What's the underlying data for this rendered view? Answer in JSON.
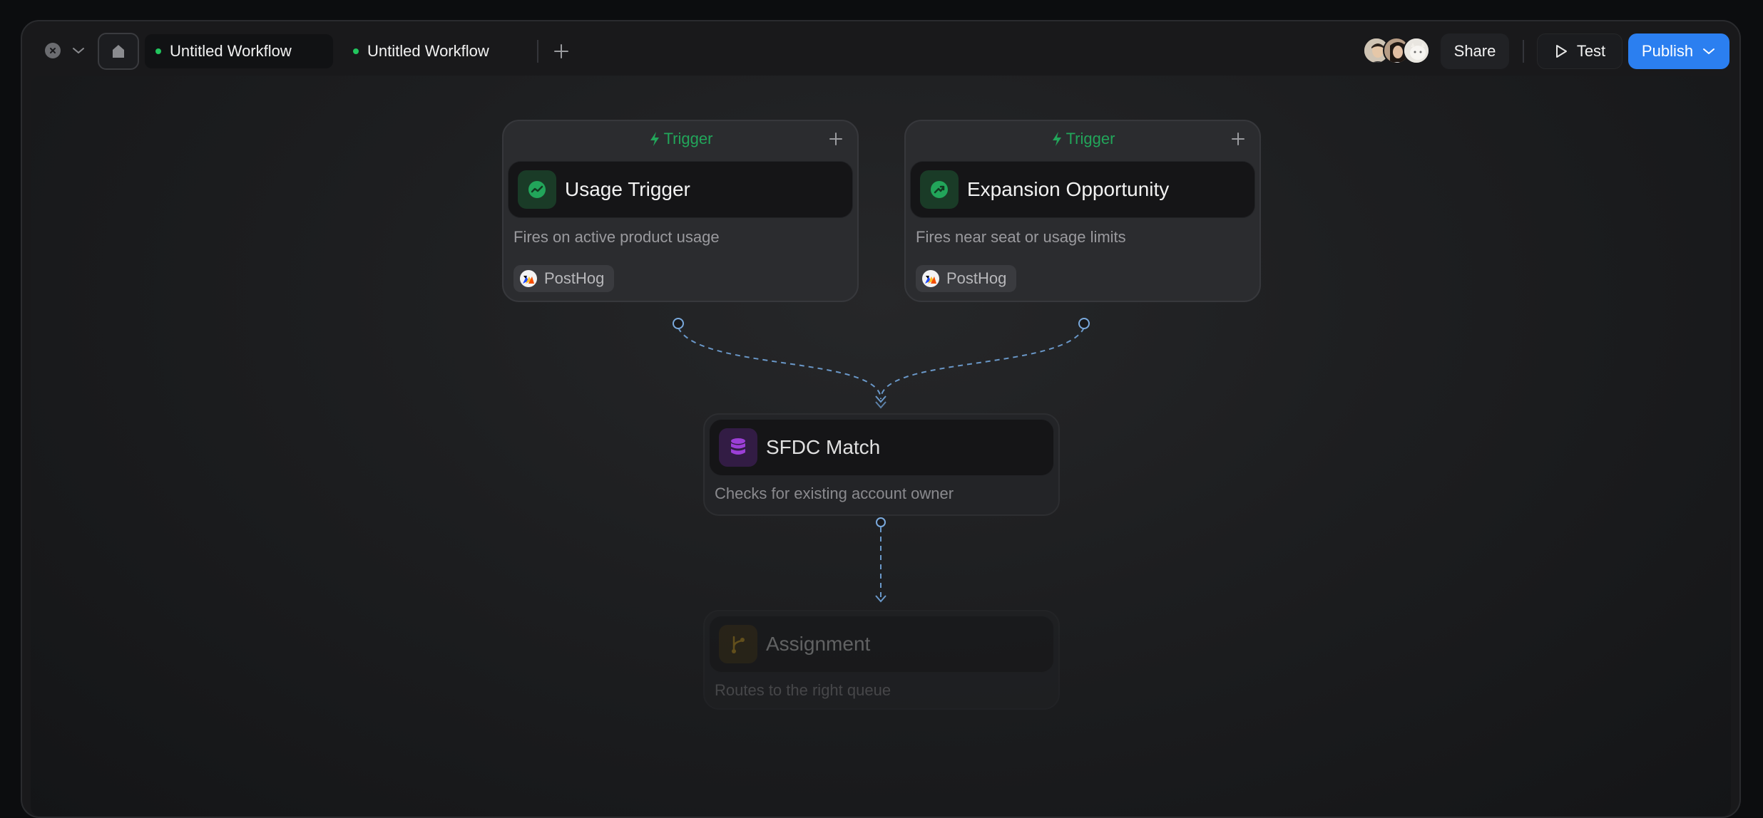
{
  "tabs": [
    {
      "label": "Untitled Workflow",
      "active": true
    },
    {
      "label": "Untitled Workflow",
      "active": false
    }
  ],
  "header": {
    "share_label": "Share",
    "test_label": "Test",
    "publish_label": "Publish"
  },
  "colors": {
    "accent": "#2b7ff0",
    "trigger_green": "#22a55a",
    "status_dot": "#22c55e",
    "sfdc_purple": "#9b3fd6",
    "assignment_amber": "#b8870f",
    "connector": "#6a98c9"
  },
  "nodes": {
    "usage": {
      "header": "Trigger",
      "title": "Usage Trigger",
      "description": "Fires on active product usage",
      "integration": "PostHog",
      "icon": "trend-icon"
    },
    "expansion": {
      "header": "Trigger",
      "title": "Expansion Opportunity",
      "description": "Fires near seat or usage limits",
      "integration": "PostHog",
      "icon": "growth-icon"
    },
    "sfdc": {
      "title": "SFDC Match",
      "description": "Checks for existing account owner",
      "icon": "database-icon"
    },
    "assignment": {
      "title": "Assignment",
      "description": "Routes to the right queue",
      "icon": "branch-icon"
    }
  }
}
